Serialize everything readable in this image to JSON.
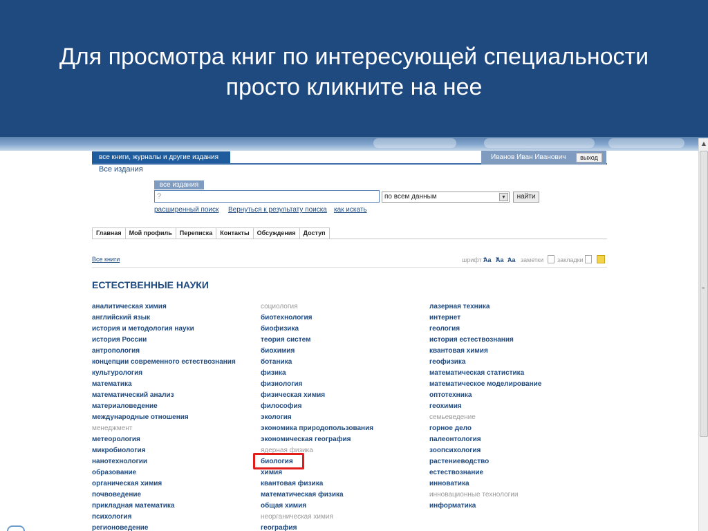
{
  "slide": {
    "title_line1": "Для просмотра книг по интересующей специальности",
    "title_line2": "просто кликните на нее"
  },
  "colors": {
    "slide_bg": "#1f4a80",
    "link": "#1f4a80",
    "highlight": "#e21b1b",
    "muted": "#9a9a9a"
  },
  "header": {
    "tab_label": "все книги, журналы и другие издания",
    "sub_label": "Все издания",
    "user_name": "Иванов Иван Иванович",
    "logout_label": "выход"
  },
  "search": {
    "tab_label": "все издания",
    "placeholder": "?",
    "scope_value": "по всем данным",
    "submit_label": "найти",
    "advanced_link": "расширенный поиск",
    "back_link": "Вернуться к результату поиска",
    "howto_link": "как искать"
  },
  "nav": {
    "tabs": [
      "Главная",
      "Мой профиль",
      "Переписка",
      "Контакты",
      "Обсуждения",
      "Доступ"
    ]
  },
  "breadcrumb": "Все книги",
  "tools": {
    "font_label": "шрифт",
    "aa": "Aa",
    "notes_label": "заметки",
    "bookmarks_label": "закладки"
  },
  "section": {
    "title": "ЕСТЕСТВЕННЫЕ НАУКИ",
    "columns": [
      [
        {
          "label": "аналитическая химия",
          "muted": false
        },
        {
          "label": "английский язык",
          "muted": false
        },
        {
          "label": "история и методология науки",
          "muted": false
        },
        {
          "label": "история России",
          "muted": false
        },
        {
          "label": "антропология",
          "muted": false
        },
        {
          "label": "концепции современного естествознания",
          "muted": false
        },
        {
          "label": "культурология",
          "muted": false
        },
        {
          "label": "математика",
          "muted": false
        },
        {
          "label": "математический анализ",
          "muted": false
        },
        {
          "label": "материаловедение",
          "muted": false
        },
        {
          "label": "международные отношения",
          "muted": false
        },
        {
          "label": "менеджмент",
          "muted": true
        },
        {
          "label": "метеорология",
          "muted": false
        },
        {
          "label": "микробиология",
          "muted": false
        },
        {
          "label": "нанотехнологии",
          "muted": false
        },
        {
          "label": "образование",
          "muted": false
        },
        {
          "label": "органическая химия",
          "muted": false
        },
        {
          "label": "почвоведение",
          "muted": false
        },
        {
          "label": "прикладная математика",
          "muted": false
        },
        {
          "label": "психология",
          "muted": false
        },
        {
          "label": "регионоведение",
          "muted": false
        }
      ],
      [
        {
          "label": "социология",
          "muted": true
        },
        {
          "label": "биотехнология",
          "muted": false
        },
        {
          "label": "биофизика",
          "muted": false
        },
        {
          "label": "теория систем",
          "muted": false
        },
        {
          "label": "биохимия",
          "muted": false
        },
        {
          "label": "ботаника",
          "muted": false
        },
        {
          "label": "физика",
          "muted": false
        },
        {
          "label": "физиология",
          "muted": false
        },
        {
          "label": "физическая химия",
          "muted": false
        },
        {
          "label": "философия",
          "muted": false
        },
        {
          "label": "экология",
          "muted": false
        },
        {
          "label": "экономика природопользования",
          "muted": false
        },
        {
          "label": "экономическая география",
          "muted": false
        },
        {
          "label": "ядерная физика",
          "muted": true
        },
        {
          "label": "биология",
          "muted": false
        },
        {
          "label": "химия",
          "muted": false
        },
        {
          "label": "квантовая физика",
          "muted": false
        },
        {
          "label": "математическая физика",
          "muted": false
        },
        {
          "label": "общая химия",
          "muted": false
        },
        {
          "label": "неорганическая химия",
          "muted": true
        },
        {
          "label": "география",
          "muted": false
        }
      ],
      [
        {
          "label": "лазерная техника",
          "muted": false
        },
        {
          "label": "интернет",
          "muted": false
        },
        {
          "label": "геология",
          "muted": false
        },
        {
          "label": "история естествознания",
          "muted": false
        },
        {
          "label": "квантовая химия",
          "muted": false
        },
        {
          "label": "геофизика",
          "muted": false
        },
        {
          "label": "математическая статистика",
          "muted": false
        },
        {
          "label": "математическое моделирование",
          "muted": false
        },
        {
          "label": "оптотехника",
          "muted": false
        },
        {
          "label": "геохимия",
          "muted": false
        },
        {
          "label": "семьеведение",
          "muted": true
        },
        {
          "label": "горное дело",
          "muted": false
        },
        {
          "label": "палеонтология",
          "muted": false
        },
        {
          "label": "зоопсихология",
          "muted": false
        },
        {
          "label": "растениеводство",
          "muted": false
        },
        {
          "label": "естествознание",
          "muted": false
        },
        {
          "label": "инноватика",
          "muted": false
        },
        {
          "label": "инновационные технологии",
          "muted": true
        },
        {
          "label": "информатика",
          "muted": false
        }
      ]
    ]
  }
}
